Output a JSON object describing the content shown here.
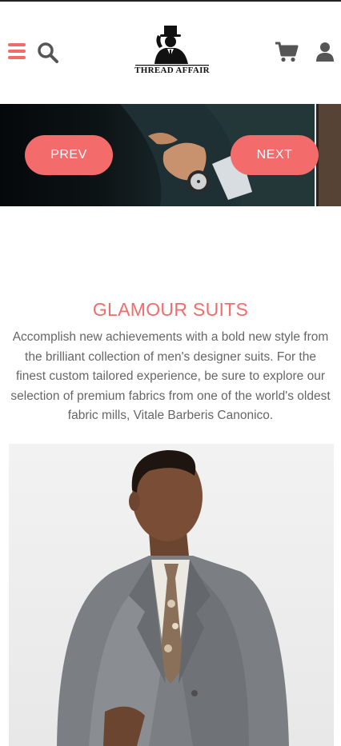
{
  "header": {
    "logo_text": "THREAD AFFAIR",
    "icons": [
      "hamburger-menu-icon",
      "search-icon",
      "cart-icon",
      "user-icon"
    ],
    "accent_color": "#f26b6b"
  },
  "hero": {
    "prev_label": "PREV",
    "next_label": "NEXT"
  },
  "section": {
    "title": "GLAMOUR SUITS",
    "body": "Accomplish new achievements with a bold new style from the brilliant collection of men's designer suits. For the finest custom tailored experience, be sure to explore our selection of premium fabrics from one of the world's oldest fabric mills, Vitale Barberis Canonico."
  }
}
